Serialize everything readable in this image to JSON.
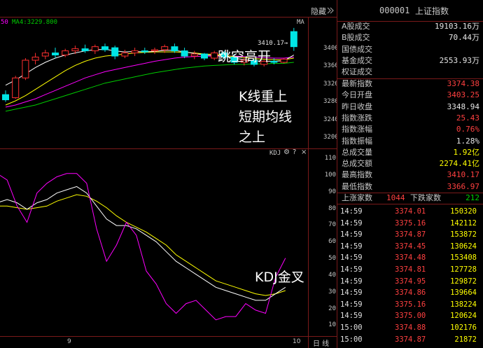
{
  "toolbar": {
    "hide_label": "隐藏",
    "ma_label": "50",
    "ma4_label": "MA4:3229.800",
    "ma_short": "MA"
  },
  "price_chart": {
    "axis_labels": [
      "3400",
      "3360",
      "3320",
      "3280",
      "3240",
      "3200"
    ],
    "high_label": "3410.17→"
  },
  "kdj_chart": {
    "title": "KDJ",
    "axis_labels": [
      "110",
      "100",
      "90",
      "80",
      "70",
      "60",
      "50",
      "40",
      "30",
      "20",
      "10"
    ]
  },
  "x_axis": {
    "labels": [
      "9",
      "10"
    ],
    "period_label": "日 线"
  },
  "annotations": {
    "gap_up": "跳空高开",
    "k_above_line1": "K线重上",
    "k_above_line2": "短期均线",
    "k_above_line3": "之上",
    "kdj_cross": "KDJ金叉"
  },
  "header": {
    "code": "000001",
    "name": "上证指数"
  },
  "volumes": [
    {
      "label": "A股成交",
      "value": "19103.16万",
      "color": "#e6e6e6"
    },
    {
      "label": "B股成交",
      "value": "70.44万",
      "color": "#e6e6e6"
    },
    {
      "label": "国债成交",
      "value": "",
      "color": "#e6e6e6"
    },
    {
      "label": "基金成交",
      "value": "2553.93万",
      "color": "#e6e6e6"
    },
    {
      "label": "权证成交",
      "value": "",
      "color": "#e6e6e6"
    }
  ],
  "quote": [
    {
      "label": "最新指数",
      "value": "3374.38",
      "color": "#ff4040"
    },
    {
      "label": "今日开盘",
      "value": "3403.25",
      "color": "#ff4040"
    },
    {
      "label": "昨日收盘",
      "value": "3348.94",
      "color": "#e6e6e6"
    },
    {
      "label": "指数涨跌",
      "value": "25.43",
      "color": "#ff4040"
    },
    {
      "label": "指数涨幅",
      "value": "0.76%",
      "color": "#ff4040"
    },
    {
      "label": "指数振幅",
      "value": "1.28%",
      "color": "#e6e6e6"
    },
    {
      "label": "总成交量",
      "value": "1.92亿",
      "color": "#ffff00"
    },
    {
      "label": "总成交额",
      "value": "2274.41亿",
      "color": "#ffff00"
    },
    {
      "label": "最高指数",
      "value": "3410.17",
      "color": "#ff4040"
    },
    {
      "label": "最低指数",
      "value": "3366.97",
      "color": "#ff4040"
    }
  ],
  "breadth": {
    "up_label": "上涨家数",
    "up_value": "1044",
    "down_label": "下跌家数",
    "down_value": "212"
  },
  "ticks": [
    {
      "time": "14:59",
      "price": "3374.01",
      "vol": "150320"
    },
    {
      "time": "14:59",
      "price": "3375.16",
      "vol": "142112"
    },
    {
      "time": "14:59",
      "price": "3374.87",
      "vol": "153872"
    },
    {
      "time": "14:59",
      "price": "3374.45",
      "vol": "130624"
    },
    {
      "time": "14:59",
      "price": "3374.48",
      "vol": "153408"
    },
    {
      "time": "14:59",
      "price": "3374.81",
      "vol": "127728"
    },
    {
      "time": "14:59",
      "price": "3374.95",
      "vol": "129872"
    },
    {
      "time": "14:59",
      "price": "3374.86",
      "vol": "139664"
    },
    {
      "time": "14:59",
      "price": "3375.16",
      "vol": "138224"
    },
    {
      "time": "14:59",
      "price": "3375.00",
      "vol": "120624"
    },
    {
      "time": "15:00",
      "price": "3374.88",
      "vol": "102176"
    },
    {
      "time": "15:00",
      "price": "3374.87",
      "vol": "21872"
    }
  ],
  "colors": {
    "up": "#ff3030",
    "down": "#00e5e5",
    "ma_white": "#ffffff",
    "ma_yellow": "#ffff00",
    "ma_magenta": "#ff00ff",
    "ma_green": "#00cc00",
    "k_line": "#ffffff",
    "d_line": "#ffff00",
    "j_line": "#ff00ff"
  },
  "price_series": {
    "ylim": [
      3180,
      3430
    ],
    "candles": [
      {
        "o": 3282,
        "h": 3290,
        "l": 3268,
        "c": 3272
      },
      {
        "o": 3276,
        "h": 3318,
        "l": 3274,
        "c": 3314
      },
      {
        "o": 3314,
        "h": 3352,
        "l": 3310,
        "c": 3348
      },
      {
        "o": 3348,
        "h": 3362,
        "l": 3340,
        "c": 3354
      },
      {
        "o": 3356,
        "h": 3368,
        "l": 3350,
        "c": 3362
      },
      {
        "o": 3362,
        "h": 3372,
        "l": 3352,
        "c": 3358
      },
      {
        "o": 3358,
        "h": 3370,
        "l": 3354,
        "c": 3366
      },
      {
        "o": 3366,
        "h": 3376,
        "l": 3360,
        "c": 3370
      },
      {
        "o": 3370,
        "h": 3378,
        "l": 3362,
        "c": 3366
      },
      {
        "o": 3366,
        "h": 3378,
        "l": 3360,
        "c": 3374
      },
      {
        "o": 3374,
        "h": 3380,
        "l": 3364,
        "c": 3368
      },
      {
        "o": 3372,
        "h": 3376,
        "l": 3350,
        "c": 3356
      },
      {
        "o": 3356,
        "h": 3368,
        "l": 3352,
        "c": 3362
      },
      {
        "o": 3362,
        "h": 3372,
        "l": 3356,
        "c": 3366
      },
      {
        "o": 3366,
        "h": 3372,
        "l": 3360,
        "c": 3364
      },
      {
        "o": 3366,
        "h": 3372,
        "l": 3360,
        "c": 3368
      },
      {
        "o": 3368,
        "h": 3378,
        "l": 3362,
        "c": 3374
      },
      {
        "o": 3374,
        "h": 3380,
        "l": 3362,
        "c": 3366
      },
      {
        "o": 3366,
        "h": 3372,
        "l": 3352,
        "c": 3356
      },
      {
        "o": 3356,
        "h": 3366,
        "l": 3350,
        "c": 3360
      },
      {
        "o": 3360,
        "h": 3362,
        "l": 3348,
        "c": 3352
      },
      {
        "o": 3352,
        "h": 3366,
        "l": 3348,
        "c": 3362
      },
      {
        "o": 3362,
        "h": 3366,
        "l": 3350,
        "c": 3354
      },
      {
        "o": 3354,
        "h": 3360,
        "l": 3340,
        "c": 3344
      },
      {
        "o": 3344,
        "h": 3352,
        "l": 3338,
        "c": 3348
      },
      {
        "o": 3348,
        "h": 3350,
        "l": 3336,
        "c": 3340
      },
      {
        "o": 3340,
        "h": 3348,
        "l": 3336,
        "c": 3346
      },
      {
        "o": 3346,
        "h": 3352,
        "l": 3340,
        "c": 3344
      },
      {
        "o": 3344,
        "h": 3352,
        "l": 3342,
        "c": 3350
      },
      {
        "o": 3403,
        "h": 3410,
        "l": 3366,
        "c": 3374
      }
    ],
    "ma_white": [
      3300,
      3310,
      3322,
      3334,
      3344,
      3352,
      3358,
      3362,
      3366,
      3368,
      3369,
      3366,
      3364,
      3365,
      3364,
      3365,
      3367,
      3367,
      3364,
      3361,
      3358,
      3357,
      3356,
      3352,
      3349,
      3347,
      3346,
      3346,
      3347,
      3358
    ],
    "ma_yellow": [
      3262,
      3270,
      3280,
      3292,
      3304,
      3316,
      3328,
      3338,
      3346,
      3352,
      3356,
      3358,
      3360,
      3362,
      3363,
      3364,
      3364,
      3364,
      3363,
      3362,
      3360,
      3359,
      3357,
      3355,
      3353,
      3351,
      3350,
      3349,
      3349,
      3352
    ],
    "ma_magenta": [
      3258,
      3262,
      3268,
      3274,
      3282,
      3290,
      3298,
      3306,
      3314,
      3320,
      3326,
      3330,
      3334,
      3338,
      3342,
      3346,
      3349,
      3352,
      3354,
      3355,
      3356,
      3356,
      3356,
      3356,
      3355,
      3354,
      3353,
      3352,
      3352,
      3354
    ],
    "ma_green": [
      3250,
      3254,
      3258,
      3262,
      3268,
      3274,
      3280,
      3286,
      3292,
      3298,
      3304,
      3308,
      3312,
      3316,
      3320,
      3324,
      3327,
      3330,
      3333,
      3335,
      3337,
      3338,
      3339,
      3340,
      3340,
      3341,
      3341,
      3342,
      3342,
      3344
    ]
  },
  "kdj_series": {
    "ylim": [
      0,
      115
    ],
    "k": [
      82,
      84,
      82,
      78,
      82,
      84,
      88,
      90,
      92,
      88,
      80,
      72,
      68,
      68,
      66,
      62,
      58,
      52,
      46,
      42,
      38,
      34,
      30,
      28,
      26,
      24,
      22,
      22,
      26,
      30
    ],
    "d": [
      80,
      80,
      79,
      78,
      79,
      80,
      83,
      85,
      87,
      86,
      83,
      79,
      74,
      70,
      67,
      64,
      60,
      56,
      50,
      46,
      42,
      38,
      34,
      32,
      30,
      28,
      26,
      25,
      26,
      28
    ],
    "j": [
      100,
      96,
      80,
      70,
      88,
      94,
      98,
      100,
      100,
      94,
      66,
      46,
      56,
      70,
      62,
      40,
      32,
      20,
      14,
      20,
      22,
      16,
      10,
      12,
      12,
      20,
      16,
      14,
      36,
      48
    ]
  }
}
